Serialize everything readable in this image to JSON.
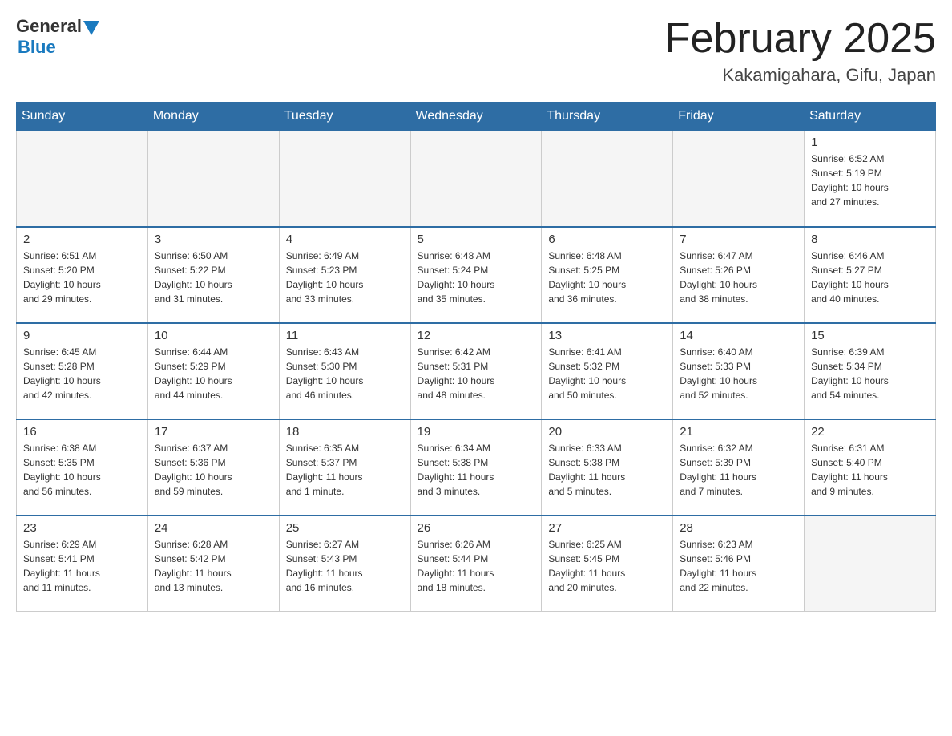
{
  "logo": {
    "general": "General",
    "blue": "Blue",
    "triangle": "▲"
  },
  "title": "February 2025",
  "subtitle": "Kakamigahara, Gifu, Japan",
  "weekdays": [
    "Sunday",
    "Monday",
    "Tuesday",
    "Wednesday",
    "Thursday",
    "Friday",
    "Saturday"
  ],
  "weeks": [
    [
      {
        "day": "",
        "info": "",
        "empty": true
      },
      {
        "day": "",
        "info": "",
        "empty": true
      },
      {
        "day": "",
        "info": "",
        "empty": true
      },
      {
        "day": "",
        "info": "",
        "empty": true
      },
      {
        "day": "",
        "info": "",
        "empty": true
      },
      {
        "day": "",
        "info": "",
        "empty": true
      },
      {
        "day": "1",
        "info": "Sunrise: 6:52 AM\nSunset: 5:19 PM\nDaylight: 10 hours\nand 27 minutes."
      }
    ],
    [
      {
        "day": "2",
        "info": "Sunrise: 6:51 AM\nSunset: 5:20 PM\nDaylight: 10 hours\nand 29 minutes."
      },
      {
        "day": "3",
        "info": "Sunrise: 6:50 AM\nSunset: 5:22 PM\nDaylight: 10 hours\nand 31 minutes."
      },
      {
        "day": "4",
        "info": "Sunrise: 6:49 AM\nSunset: 5:23 PM\nDaylight: 10 hours\nand 33 minutes."
      },
      {
        "day": "5",
        "info": "Sunrise: 6:48 AM\nSunset: 5:24 PM\nDaylight: 10 hours\nand 35 minutes."
      },
      {
        "day": "6",
        "info": "Sunrise: 6:48 AM\nSunset: 5:25 PM\nDaylight: 10 hours\nand 36 minutes."
      },
      {
        "day": "7",
        "info": "Sunrise: 6:47 AM\nSunset: 5:26 PM\nDaylight: 10 hours\nand 38 minutes."
      },
      {
        "day": "8",
        "info": "Sunrise: 6:46 AM\nSunset: 5:27 PM\nDaylight: 10 hours\nand 40 minutes."
      }
    ],
    [
      {
        "day": "9",
        "info": "Sunrise: 6:45 AM\nSunset: 5:28 PM\nDaylight: 10 hours\nand 42 minutes."
      },
      {
        "day": "10",
        "info": "Sunrise: 6:44 AM\nSunset: 5:29 PM\nDaylight: 10 hours\nand 44 minutes."
      },
      {
        "day": "11",
        "info": "Sunrise: 6:43 AM\nSunset: 5:30 PM\nDaylight: 10 hours\nand 46 minutes."
      },
      {
        "day": "12",
        "info": "Sunrise: 6:42 AM\nSunset: 5:31 PM\nDaylight: 10 hours\nand 48 minutes."
      },
      {
        "day": "13",
        "info": "Sunrise: 6:41 AM\nSunset: 5:32 PM\nDaylight: 10 hours\nand 50 minutes."
      },
      {
        "day": "14",
        "info": "Sunrise: 6:40 AM\nSunset: 5:33 PM\nDaylight: 10 hours\nand 52 minutes."
      },
      {
        "day": "15",
        "info": "Sunrise: 6:39 AM\nSunset: 5:34 PM\nDaylight: 10 hours\nand 54 minutes."
      }
    ],
    [
      {
        "day": "16",
        "info": "Sunrise: 6:38 AM\nSunset: 5:35 PM\nDaylight: 10 hours\nand 56 minutes."
      },
      {
        "day": "17",
        "info": "Sunrise: 6:37 AM\nSunset: 5:36 PM\nDaylight: 10 hours\nand 59 minutes."
      },
      {
        "day": "18",
        "info": "Sunrise: 6:35 AM\nSunset: 5:37 PM\nDaylight: 11 hours\nand 1 minute."
      },
      {
        "day": "19",
        "info": "Sunrise: 6:34 AM\nSunset: 5:38 PM\nDaylight: 11 hours\nand 3 minutes."
      },
      {
        "day": "20",
        "info": "Sunrise: 6:33 AM\nSunset: 5:38 PM\nDaylight: 11 hours\nand 5 minutes."
      },
      {
        "day": "21",
        "info": "Sunrise: 6:32 AM\nSunset: 5:39 PM\nDaylight: 11 hours\nand 7 minutes."
      },
      {
        "day": "22",
        "info": "Sunrise: 6:31 AM\nSunset: 5:40 PM\nDaylight: 11 hours\nand 9 minutes."
      }
    ],
    [
      {
        "day": "23",
        "info": "Sunrise: 6:29 AM\nSunset: 5:41 PM\nDaylight: 11 hours\nand 11 minutes."
      },
      {
        "day": "24",
        "info": "Sunrise: 6:28 AM\nSunset: 5:42 PM\nDaylight: 11 hours\nand 13 minutes."
      },
      {
        "day": "25",
        "info": "Sunrise: 6:27 AM\nSunset: 5:43 PM\nDaylight: 11 hours\nand 16 minutes."
      },
      {
        "day": "26",
        "info": "Sunrise: 6:26 AM\nSunset: 5:44 PM\nDaylight: 11 hours\nand 18 minutes."
      },
      {
        "day": "27",
        "info": "Sunrise: 6:25 AM\nSunset: 5:45 PM\nDaylight: 11 hours\nand 20 minutes."
      },
      {
        "day": "28",
        "info": "Sunrise: 6:23 AM\nSunset: 5:46 PM\nDaylight: 11 hours\nand 22 minutes."
      },
      {
        "day": "",
        "info": "",
        "empty": true
      }
    ]
  ]
}
